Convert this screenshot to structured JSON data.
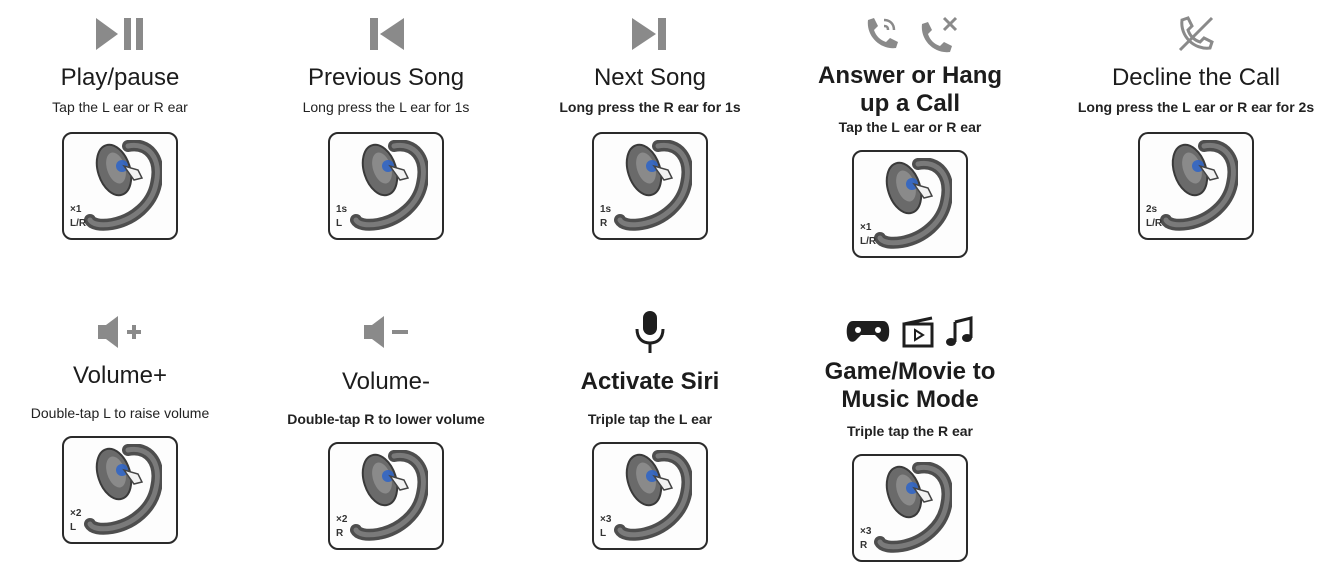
{
  "colors": {
    "icon_gray": "#8a8a8a",
    "ear_dark": "#5a5a5a",
    "tap_blue": "#2b63c8",
    "border": "#2a2a2a"
  },
  "items": [
    {
      "icons": [
        "play-pause-icon"
      ],
      "title": "Play/pause",
      "desc": "Tap the L ear or R ear",
      "badge1": "×1",
      "badge2": "L/R"
    },
    {
      "icons": [
        "previous-track-icon"
      ],
      "title": "Previous Song",
      "desc": "Long press the L ear for 1s",
      "badge1": "1s",
      "badge2": "L"
    },
    {
      "icons": [
        "next-track-icon"
      ],
      "title": "Next Song",
      "desc": "Long press the R ear for 1s",
      "badge1": "1s",
      "badge2": "R"
    },
    {
      "icons": [
        "answer-call-icon",
        "hang-up-call-icon"
      ],
      "title": "Answer or Hang",
      "title2": "up a Call",
      "desc": "Tap the L ear or R ear",
      "badge1": "×1",
      "badge2": "L/R"
    },
    {
      "icons": [
        "decline-call-icon"
      ],
      "title": "Decline the Call",
      "desc": "Long press the L ear or R ear for 2s",
      "badge1": "2s",
      "badge2": "L/R"
    },
    {
      "icons": [
        "volume-up-icon"
      ],
      "title": "Volume+",
      "desc": "Double-tap L to raise volume",
      "badge1": "×2",
      "badge2": "L"
    },
    {
      "icons": [
        "volume-down-icon"
      ],
      "title": "Volume-",
      "desc": "Double-tap R to lower volume",
      "badge1": "×2",
      "badge2": "R"
    },
    {
      "icons": [
        "microphone-icon"
      ],
      "title": "Activate Siri",
      "desc": "Triple tap the L ear",
      "badge1": "×3",
      "badge2": "L"
    },
    {
      "icons": [
        "gamepad-icon",
        "movie-icon",
        "music-note-icon"
      ],
      "title": "Game/Movie to",
      "title2": "Music Mode",
      "desc": "Triple tap the R ear",
      "badge1": "×3",
      "badge2": "R"
    }
  ]
}
